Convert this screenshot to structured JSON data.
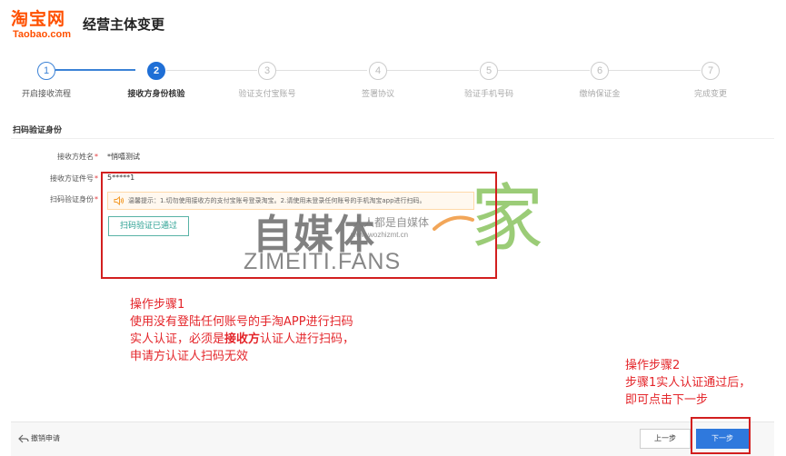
{
  "brand": {
    "logo_cn": "淘宝网",
    "logo_en": "Taobao.com",
    "color": "#ff5000"
  },
  "page_title": "经营主体变更",
  "steps": [
    {
      "number": "1",
      "label": "开启接收流程",
      "state": "done"
    },
    {
      "number": "2",
      "label": "接收方身份核验",
      "state": "active"
    },
    {
      "number": "3",
      "label": "验证支付宝账号",
      "state": "pending"
    },
    {
      "number": "4",
      "label": "签署协议",
      "state": "pending"
    },
    {
      "number": "5",
      "label": "验证手机号码",
      "state": "pending"
    },
    {
      "number": "6",
      "label": "缴纳保证金",
      "state": "pending"
    },
    {
      "number": "7",
      "label": "完成变更",
      "state": "pending"
    }
  ],
  "section": {
    "title": "扫码验证身份"
  },
  "form": {
    "receiver_name_label": "接收方姓名",
    "receiver_name_value": "*悄嘻测试",
    "receiver_id_label": "接收方证件号",
    "receiver_id_value": "5*****1",
    "scan_verify_label": "扫码验证身份",
    "required_mark": "*",
    "tip_text": "温馨提示：1.切勿使用接收方的支付宝账号登录淘宝。2.请使用未登录任何账号的手机淘宝app进行扫码。",
    "scan_status_button": "扫码验证已通过"
  },
  "watermark": {
    "big": "自媒体",
    "sub_cn": "人人都是自媒体",
    "sub_url": "www.wozhizmt.cn",
    "jia": "家",
    "en": "ZIMEITI.FANS"
  },
  "annotations": {
    "step1_title": "操作步骤1",
    "step1_line1": "使用没有登陆任何账号的手淘APP进行扫码",
    "step1_line2_a": "实人认证，必须是",
    "step1_line2_b": "接收方",
    "step1_line2_c": "认证人进行扫码，",
    "step1_line3": "申请方认证人扫码无效",
    "step2_title": "操作步骤2",
    "step2_line1": "步骤1实人认证通过后，",
    "step2_line2": "即可点击下一步"
  },
  "footer": {
    "revoke_label": "撤销申请",
    "prev_label": "上一步",
    "next_label": "下一步"
  },
  "colors": {
    "primary": "#2f79dd",
    "step_active": "#1f6fd6",
    "annotation_red": "#e4252a",
    "success_green": "#2aa092"
  },
  "icons": {
    "tip": "speaker-icon",
    "revoke": "back-arrow-icon"
  }
}
